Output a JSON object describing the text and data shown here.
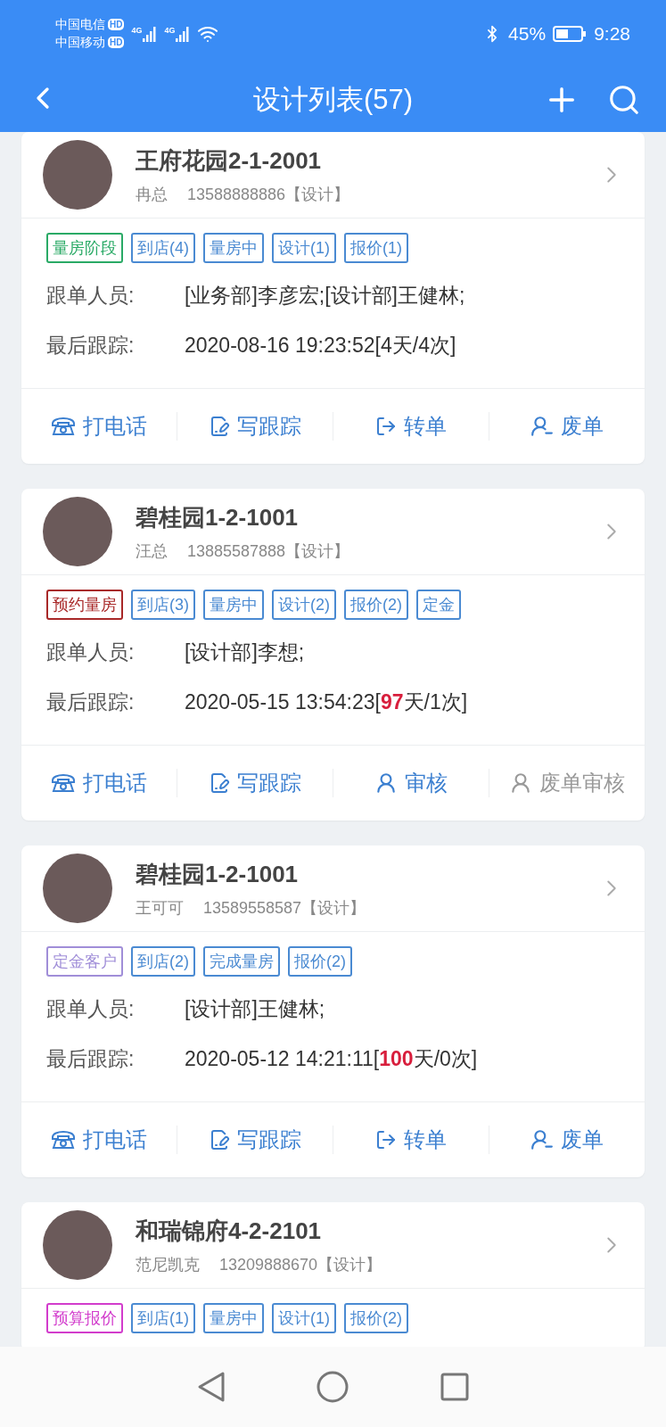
{
  "status_bar": {
    "carriers": [
      {
        "name": "中国电信",
        "badge": "HD"
      },
      {
        "name": "中国移动",
        "badge": "HD"
      }
    ],
    "networks": [
      "4G",
      "4G"
    ],
    "battery": "45%",
    "time": "9:28"
  },
  "header": {
    "title": "设计列表(57)"
  },
  "cards": [
    {
      "title": "王府花园2-1-2001",
      "contact": "冉总",
      "phone": "13588888886【设计】",
      "tags": [
        {
          "label": "量房阶段",
          "color": "#2aaa66"
        },
        {
          "label": "到店(4)",
          "color": "#4a8ad2"
        },
        {
          "label": "量房中",
          "color": "#4a8ad2"
        },
        {
          "label": "设计(1)",
          "color": "#4a8ad2"
        },
        {
          "label": "报价(1)",
          "color": "#4a8ad2"
        }
      ],
      "staff": {
        "label": "跟单人员:",
        "value": "[业务部]李彦宏;[设计部]王健林;"
      },
      "last_track": {
        "label": "最后跟踪:",
        "value": "2020-08-16 19:23:52[4天/4次]"
      },
      "actions": [
        {
          "kind": "call",
          "label": "打电话",
          "disabled": false
        },
        {
          "kind": "track",
          "label": "写跟踪",
          "disabled": false
        },
        {
          "kind": "transfer",
          "label": "转单",
          "disabled": false
        },
        {
          "kind": "void",
          "label": "废单",
          "disabled": false
        }
      ]
    },
    {
      "title": "碧桂园1-2-1001",
      "contact": "汪总",
      "phone": "13885587888【设计】",
      "tags": [
        {
          "label": "预约量房",
          "color": "#a82828"
        },
        {
          "label": "到店(3)",
          "color": "#4a8ad2"
        },
        {
          "label": "量房中",
          "color": "#4a8ad2"
        },
        {
          "label": "设计(2)",
          "color": "#4a8ad2"
        },
        {
          "label": "报价(2)",
          "color": "#4a8ad2"
        },
        {
          "label": "定金",
          "color": "#4a8ad2"
        }
      ],
      "staff": {
        "label": "跟单人员:",
        "value": "[设计部]李想;"
      },
      "last_track": {
        "label": "最后跟踪:",
        "value": "2020-05-15 13:54:23[**97**天/1次]"
      },
      "actions": [
        {
          "kind": "call",
          "label": "打电话",
          "disabled": false
        },
        {
          "kind": "track",
          "label": "写跟踪",
          "disabled": false
        },
        {
          "kind": "review",
          "label": "审核",
          "disabled": false
        },
        {
          "kind": "review",
          "label": "废单审核",
          "disabled": true
        }
      ]
    },
    {
      "title": "碧桂园1-2-1001",
      "contact": "王可可",
      "phone": "13589558587【设计】",
      "tags": [
        {
          "label": "定金客户",
          "color": "#a08ed8"
        },
        {
          "label": "到店(2)",
          "color": "#4a8ad2"
        },
        {
          "label": "完成量房",
          "color": "#4a8ad2"
        },
        {
          "label": "报价(2)",
          "color": "#4a8ad2"
        }
      ],
      "staff": {
        "label": "跟单人员:",
        "value": "[设计部]王健林;"
      },
      "last_track": {
        "label": "最后跟踪:",
        "value": "2020-05-12 14:21:11[**100**天/0次]"
      },
      "actions": [
        {
          "kind": "call",
          "label": "打电话",
          "disabled": false
        },
        {
          "kind": "track",
          "label": "写跟踪",
          "disabled": false
        },
        {
          "kind": "transfer",
          "label": "转单",
          "disabled": false
        },
        {
          "kind": "void",
          "label": "废单",
          "disabled": false
        }
      ]
    },
    {
      "title": "和瑞锦府4-2-2101",
      "contact": "范尼凯克",
      "phone": "13209888670【设计】",
      "tags": [
        {
          "label": "预算报价",
          "color": "#d23ccc"
        },
        {
          "label": "到店(1)",
          "color": "#4a8ad2"
        },
        {
          "label": "量房中",
          "color": "#4a8ad2"
        },
        {
          "label": "设计(1)",
          "color": "#4a8ad2"
        },
        {
          "label": "报价(2)",
          "color": "#4a8ad2"
        }
      ]
    }
  ]
}
